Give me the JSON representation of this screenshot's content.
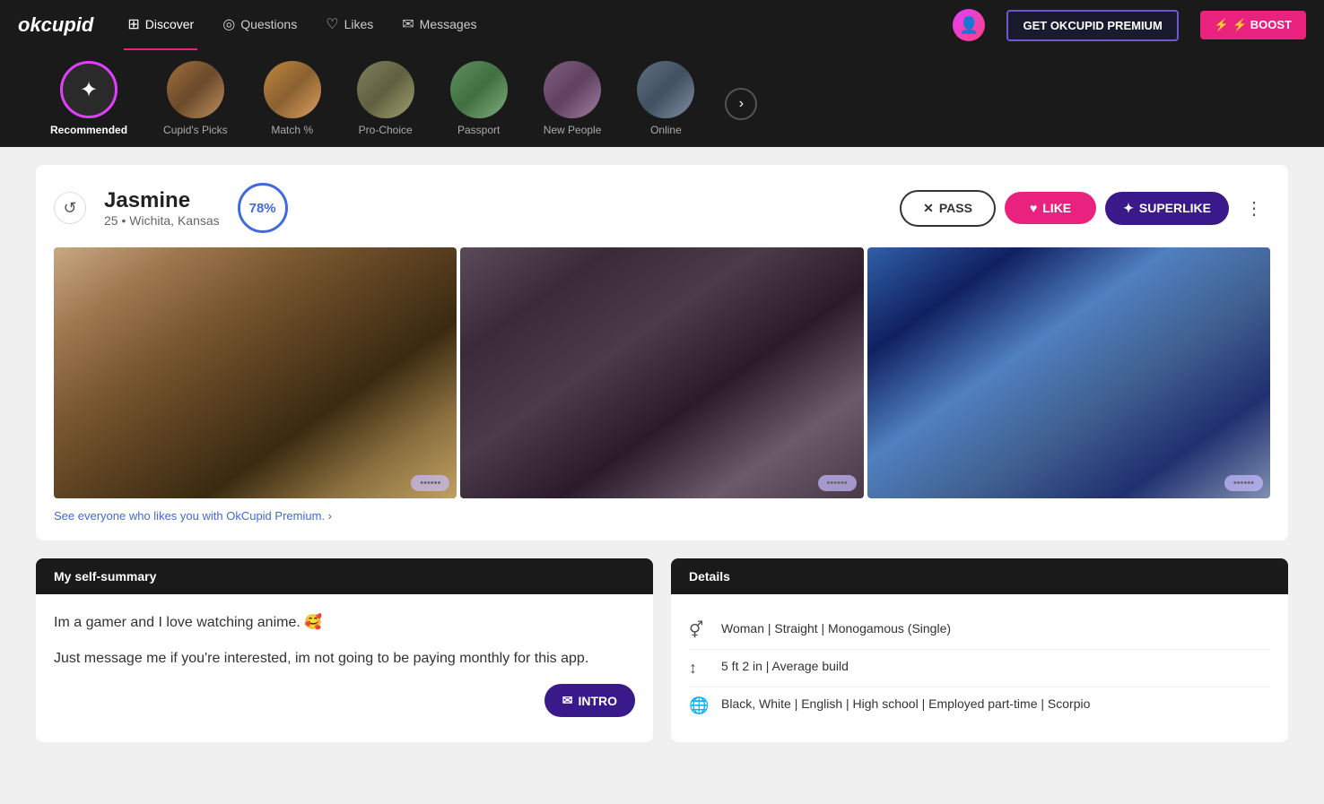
{
  "app": {
    "logo": "okcupid",
    "premium_label": "GET OKCUPID PREMIUM",
    "boost_label": "⚡ BOOST"
  },
  "nav": {
    "items": [
      {
        "id": "discover",
        "label": "Discover",
        "icon": "⊞",
        "active": true
      },
      {
        "id": "questions",
        "label": "Questions",
        "icon": "◎"
      },
      {
        "id": "likes",
        "label": "Likes",
        "icon": "♡"
      },
      {
        "id": "messages",
        "label": "Messages",
        "icon": "✉"
      }
    ]
  },
  "tabs": [
    {
      "id": "recommended",
      "label": "Recommended",
      "icon": "✦",
      "active": true
    },
    {
      "id": "cupids-picks",
      "label": "Cupid's Picks",
      "icon": "photo"
    },
    {
      "id": "match",
      "label": "Match %",
      "icon": "photo"
    },
    {
      "id": "pro-choice",
      "label": "Pro-Choice",
      "icon": "photo"
    },
    {
      "id": "passport",
      "label": "Passport",
      "icon": "photo"
    },
    {
      "id": "new-people",
      "label": "New People",
      "icon": "photo"
    },
    {
      "id": "online",
      "label": "Online",
      "icon": "photo"
    }
  ],
  "profile": {
    "name": "Jasmine",
    "age": "25",
    "location": "Wichita, Kansas",
    "match_percent": "78%",
    "pass_label": "PASS",
    "like_label": "LIKE",
    "superlike_label": "SUPERLIKE",
    "photos": [
      {
        "color1": "#c4a882",
        "color2": "#8b6545"
      },
      {
        "color1": "#6a5a6a",
        "color2": "#3a2a3a"
      },
      {
        "color1": "#4060a0",
        "color2": "#203060"
      }
    ],
    "premium_link": "See everyone who likes you with OkCupid Premium. ›",
    "self_summary_header": "My self-summary",
    "self_summary_text1": "Im a gamer and I love watching anime. 🥰",
    "self_summary_text2": "Just message me if you're interested, im not going to be paying monthly for this app.",
    "intro_label": "INTRO",
    "details_header": "Details",
    "details": [
      {
        "icon": "⚥",
        "text": "Woman | Straight | Monogamous (Single)"
      },
      {
        "icon": "↕",
        "text": "5 ft 2 in | Average build"
      },
      {
        "icon": "🌐",
        "text": "Black, White | English | High school | Employed part-time | Scorpio"
      }
    ]
  }
}
